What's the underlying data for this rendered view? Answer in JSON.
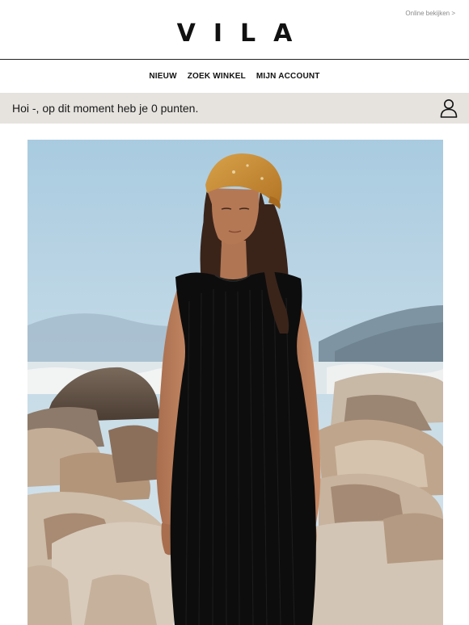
{
  "header": {
    "online_link": "Online bekijken >",
    "logo": "VILA"
  },
  "nav": {
    "items": [
      {
        "label": "NIEUW"
      },
      {
        "label": "ZOEK WINKEL"
      },
      {
        "label": "MIJN ACCOUNT"
      }
    ]
  },
  "points_bar": {
    "text": "Hoi -, op dit moment heb je 0 punten.",
    "icon": "user-icon"
  },
  "hero": {
    "icon": "hero-photo"
  },
  "colors": {
    "points_bar_bg": "#e6e3df",
    "sky": "#b8d3e2",
    "dress": "#0d0d0d",
    "headscarf": "#c98e2e"
  }
}
